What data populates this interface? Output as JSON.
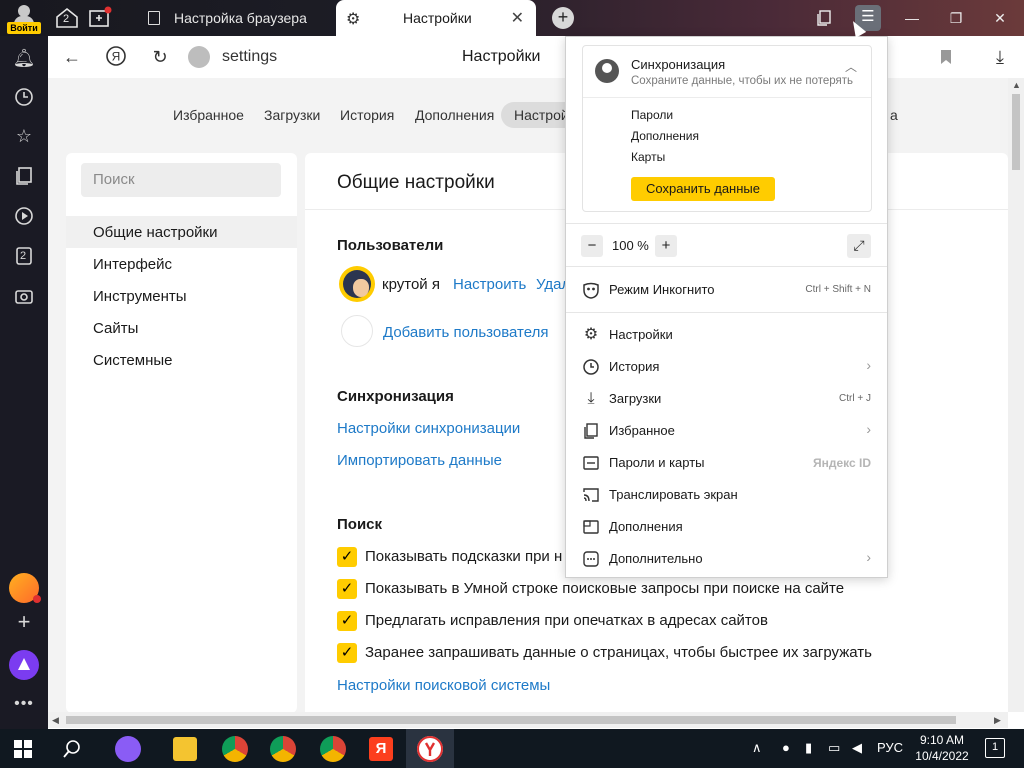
{
  "titlebar": {
    "login_label": "Войти",
    "tab_count_badge": "2",
    "tabs": [
      {
        "title": "Настройка браузера",
        "active": false
      },
      {
        "title": "Настройки",
        "active": true
      }
    ]
  },
  "sidebar": {
    "tabs_badge": "2"
  },
  "addressbar": {
    "url": "settings",
    "page_title": "Настройки"
  },
  "topnav": {
    "items": [
      "Избранное",
      "Загрузки",
      "История",
      "Дополнения",
      "Настройки"
    ],
    "hidden_tail": "а"
  },
  "leftnav": {
    "search_placeholder": "Поиск",
    "items": [
      "Общие настройки",
      "Интерфейс",
      "Инструменты",
      "Сайты",
      "Системные"
    ]
  },
  "main": {
    "title": "Общие настройки",
    "users": {
      "title": "Пользователи",
      "user_name": "крутой я",
      "configure": "Настроить",
      "delete_partial": "Удал",
      "add_user": "Добавить пользователя"
    },
    "sync": {
      "title": "Синхронизация",
      "settings_link": "Настройки синхронизации",
      "import_link": "Импортировать данные"
    },
    "search": {
      "title": "Поиск",
      "options": [
        "Показывать подсказки при н",
        "Показывать в Умной строке поисковые запросы при поиске на сайте",
        "Предлагать исправления при опечатках в адресах сайтов",
        "Заранее запрашивать данные о страницах, чтобы быстрее их загружать"
      ],
      "engine_link": "Настройки поисковой системы"
    }
  },
  "menu": {
    "sync_card": {
      "title": "Синхронизация",
      "subtitle": "Сохраните данные, чтобы их не потерять",
      "items": [
        "Пароли",
        "Дополнения",
        "Карты"
      ],
      "save_button": "Сохранить данные"
    },
    "zoom": {
      "minus": "−",
      "value": "100 %",
      "plus": "+"
    },
    "incognito": {
      "label": "Режим Инкогнито",
      "shortcut": "Ctrl + Shift + N"
    },
    "items": [
      {
        "label": "Настройки",
        "shortcut": "",
        "submenu": false,
        "icon": "gear-icon"
      },
      {
        "label": "История",
        "shortcut": "",
        "submenu": true,
        "icon": "clock-icon"
      },
      {
        "label": "Загрузки",
        "shortcut": "Ctrl + J",
        "submenu": false,
        "icon": "download-icon"
      },
      {
        "label": "Избранное",
        "shortcut": "",
        "submenu": true,
        "icon": "bookmark-icon"
      },
      {
        "label": "Пароли и карты",
        "shortcut": "",
        "submenu": false,
        "icon": "key-icon"
      },
      {
        "label": "Транслировать экран",
        "shortcut": "",
        "submenu": false,
        "icon": "cast-icon"
      },
      {
        "label": "Дополнения",
        "shortcut": "",
        "submenu": false,
        "icon": "puzzle-icon"
      },
      {
        "label": "Дополнительно",
        "shortcut": "",
        "submenu": true,
        "icon": "more-icon"
      }
    ],
    "yandex_id": "Яндекс ID"
  },
  "taskbar": {
    "language": "РУС",
    "time": "9:10 AM",
    "date": "10/4/2022",
    "notifications": "1"
  },
  "colors": {
    "accent_yellow": "#ffcc00",
    "link_blue": "#1e7ac8",
    "sidebar_dark": "#1a1a24"
  }
}
